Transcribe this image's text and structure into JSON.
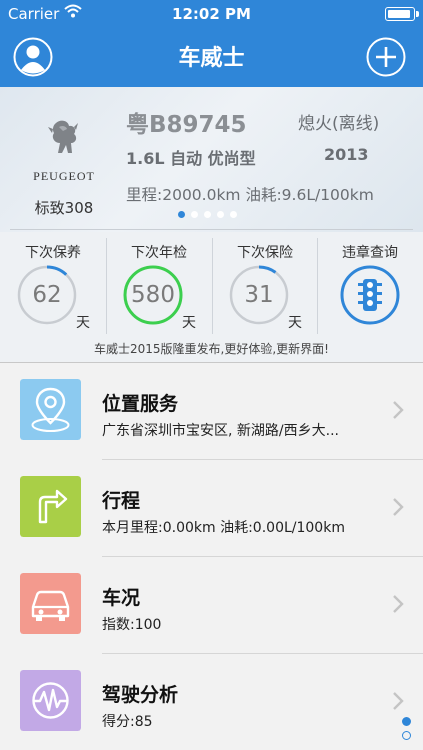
{
  "status": {
    "carrier": "Carrier",
    "time": "12:02 PM"
  },
  "nav": {
    "title": "车威士"
  },
  "car": {
    "brand": "PEUGEOT",
    "model": "标致308",
    "plate": "粤B89745",
    "engine_status": "熄火(离线)",
    "spec": "1.6L 自动 优尚型",
    "year": "2013",
    "stats": "里程:2000.0km 油耗:9.6L/100km",
    "page_count": 5,
    "page_index": 0
  },
  "reminders": [
    {
      "label": "下次保养",
      "value": "62",
      "unit": "天",
      "progress": 0.12,
      "color": "#2f86d8"
    },
    {
      "label": "下次年检",
      "value": "580",
      "unit": "天",
      "progress": 1.0,
      "color": "#3ccf4e"
    },
    {
      "label": "下次保险",
      "value": "31",
      "unit": "天",
      "progress": 0.1,
      "color": "#2f86d8"
    },
    {
      "label": "违章查询",
      "icon": "traffic-light-icon",
      "color": "#2f86d8"
    }
  ],
  "notice": "车威士2015版隆重发布,更好体验,更新界面!",
  "services": [
    {
      "title": "位置服务",
      "subtitle": "广东省深圳市宝安区, 新湖路/西乡大...",
      "icon": "location-pin-icon",
      "color": "#8ccaf0"
    },
    {
      "title": "行程",
      "subtitle": "本月里程:0.00km 油耗:0.00L/100km",
      "icon": "route-sign-icon",
      "color": "#a9cf47"
    },
    {
      "title": "车况",
      "subtitle": "指数:100",
      "icon": "car-icon",
      "color": "#f39a8e"
    },
    {
      "title": "驾驶分析",
      "subtitle": "得分:85",
      "icon": "pulse-icon",
      "color": "#c2a9e6"
    }
  ],
  "list_page": {
    "count": 2,
    "index": 0
  }
}
